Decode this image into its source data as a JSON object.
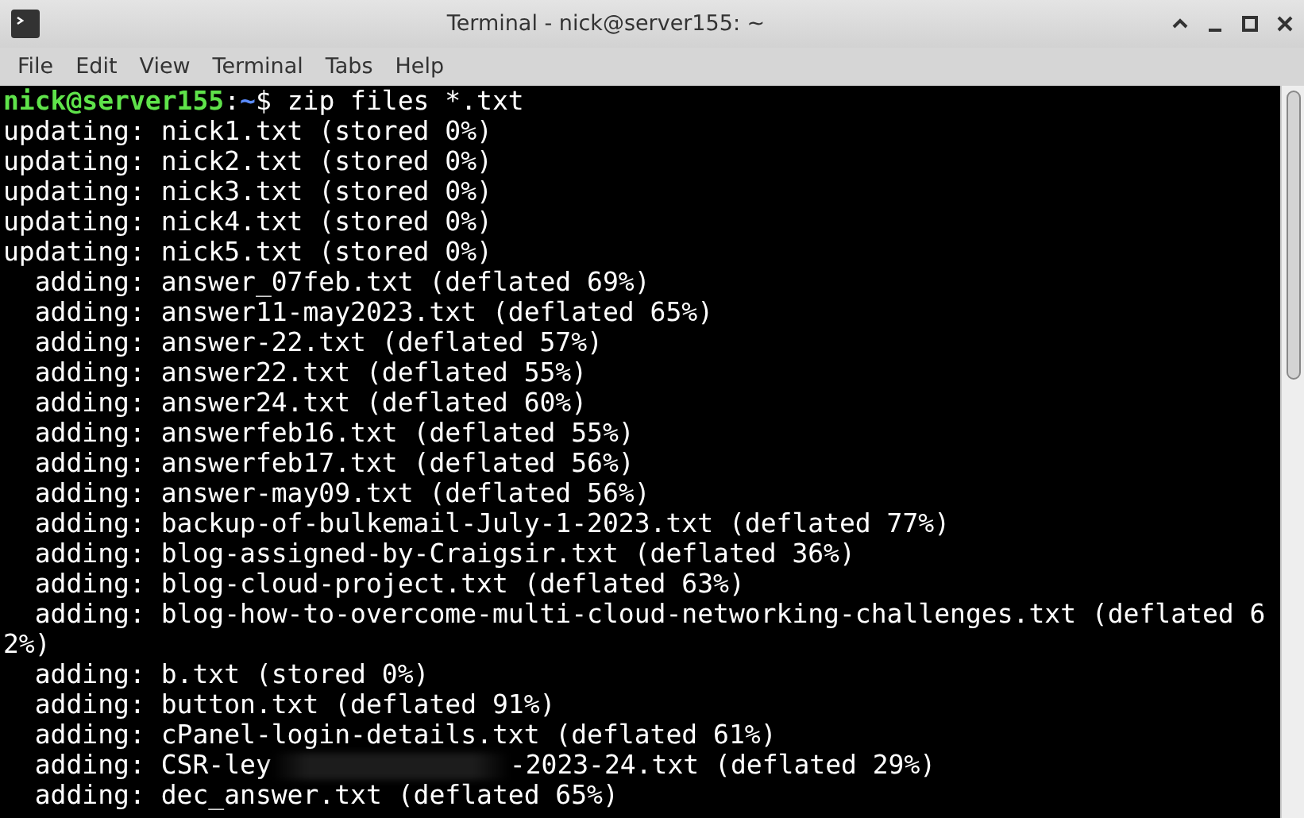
{
  "window": {
    "title": "Terminal - nick@server155: ~"
  },
  "menu": [
    "File",
    "Edit",
    "View",
    "Terminal",
    "Tabs",
    "Help"
  ],
  "terminal": {
    "lines": [
      {
        "kind": "prompt",
        "user": "nick@server155",
        "sep": ":",
        "path": "~",
        "command": "$ zip files *.txt"
      },
      {
        "kind": "output",
        "text": "updating: nick1.txt (stored 0%)"
      },
      {
        "kind": "output",
        "text": "updating: nick2.txt (stored 0%)"
      },
      {
        "kind": "output",
        "text": "updating: nick3.txt (stored 0%)"
      },
      {
        "kind": "output",
        "text": "updating: nick4.txt (stored 0%)"
      },
      {
        "kind": "output",
        "text": "updating: nick5.txt (stored 0%)"
      },
      {
        "kind": "output",
        "text": "  adding: answer_07feb.txt (deflated 69%)"
      },
      {
        "kind": "output",
        "text": "  adding: answer11-may2023.txt (deflated 65%)"
      },
      {
        "kind": "output",
        "text": "  adding: answer-22.txt (deflated 57%)"
      },
      {
        "kind": "output",
        "text": "  adding: answer22.txt (deflated 55%)"
      },
      {
        "kind": "output",
        "text": "  adding: answer24.txt (deflated 60%)"
      },
      {
        "kind": "output",
        "text": "  adding: answerfeb16.txt (deflated 55%)"
      },
      {
        "kind": "output",
        "text": "  adding: answerfeb17.txt (deflated 56%)"
      },
      {
        "kind": "output",
        "text": "  adding: answer-may09.txt (deflated 56%)"
      },
      {
        "kind": "output",
        "text": "  adding: backup-of-bulkemail-July-1-2023.txt (deflated 77%)"
      },
      {
        "kind": "output",
        "text": "  adding: blog-assigned-by-Craigsir.txt (deflated 36%)"
      },
      {
        "kind": "output",
        "text": "  adding: blog-cloud-project.txt (deflated 63%)"
      },
      {
        "kind": "output",
        "text": "  adding: blog-how-to-overcome-multi-cloud-networking-challenges.txt (deflated 6"
      },
      {
        "kind": "output",
        "text": "2%)"
      },
      {
        "kind": "output",
        "text": "  adding: b.txt (stored 0%)"
      },
      {
        "kind": "output",
        "text": "  adding: button.txt (deflated 91%)"
      },
      {
        "kind": "output",
        "text": "  adding: cPanel-login-details.txt (deflated 61%)"
      },
      {
        "kind": "redacted",
        "before": "  adding: CSR-ley",
        "after": "-2023-24.txt (deflated 29%)"
      },
      {
        "kind": "output",
        "text": "  adding: dec_answer.txt (deflated 65%)"
      }
    ]
  }
}
